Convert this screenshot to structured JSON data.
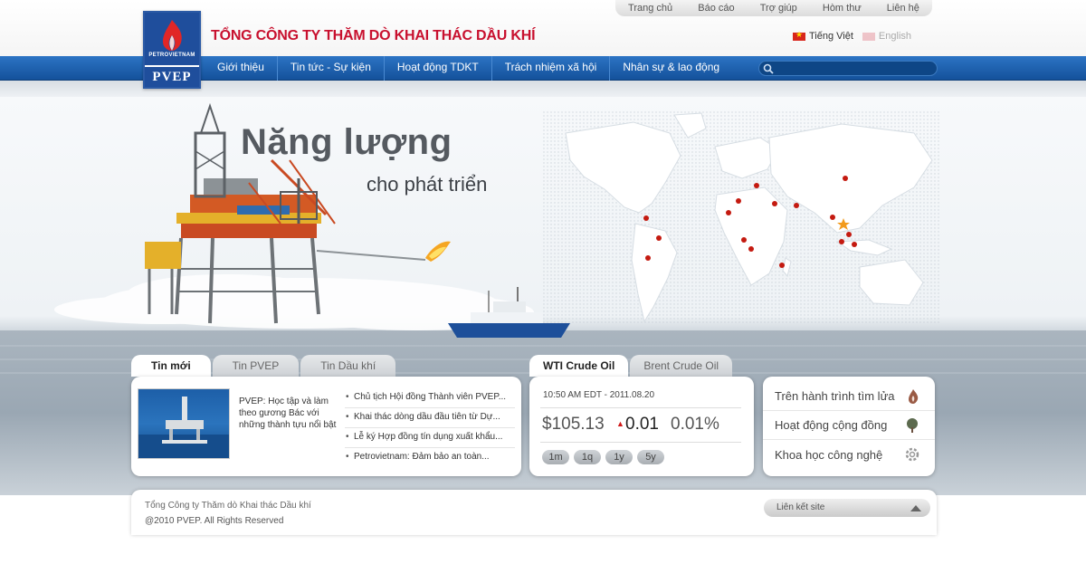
{
  "utility_nav": [
    "Trang chủ",
    "Báo cáo",
    "Trợ giúp",
    "Hòm thư",
    "Liên hệ"
  ],
  "logo": {
    "top_text": "PETROVIETNAM",
    "bottom_text": "PVEP",
    "icon": "flame-logo-icon"
  },
  "company_title": "TỔNG CÔNG TY THĂM DÒ KHAI THÁC DẦU KHÍ",
  "languages": {
    "vi": "Tiếng Việt",
    "en": "English"
  },
  "main_nav": [
    "Giới thiệu",
    "Tin tức - Sự kiện",
    "Hoạt động TDKT",
    "Trách nhiệm xã hội",
    "Nhân sự & lao động"
  ],
  "search": {
    "placeholder": "",
    "icon": "search-icon"
  },
  "banner": {
    "headline": "Năng lượng",
    "subheadline": "cho phát triển"
  },
  "news": {
    "tabs": [
      "Tin mới",
      "Tin PVEP",
      "Tin Dầu khí"
    ],
    "feature": "PVEP: Học tập và làm theo gương Bác với những thành tựu nổi bật",
    "items": [
      "Chủ tịch Hội đồng Thành viên PVEP...",
      "Khai thác dòng dầu đầu tiên từ Dự...",
      "Lễ ký Hợp đồng tín dụng xuất khẩu...",
      "Petrovietnam: Đảm bảo an toàn..."
    ]
  },
  "oil_price": {
    "tabs": [
      "WTI Crude Oil",
      "Brent Crude Oil"
    ],
    "timestamp": "10:50 AM EDT - 2011.08.20",
    "price": "$105.13",
    "change": "0.01",
    "percent": "0.01%",
    "change_color": "#d01818",
    "ranges": [
      "1m",
      "1q",
      "1y",
      "5y"
    ]
  },
  "quick_links": [
    {
      "label": "Trên hành trình tìm lửa",
      "icon": "flame-icon"
    },
    {
      "label": "Hoạt động cộng đồng",
      "icon": "tree-icon"
    },
    {
      "label": "Khoa học công nghệ",
      "icon": "gear-icon"
    }
  ],
  "footer": {
    "company": "Tổng Công ty Thăm dò Khai thác Dầu khí",
    "copyright": "@2010 PVEP. All Rights Reserved",
    "site_links": "Liên kết site"
  },
  "colors": {
    "brand_red": "#c8102e",
    "nav_blue": "#1b5fae",
    "map_marker": "#c41a10"
  }
}
